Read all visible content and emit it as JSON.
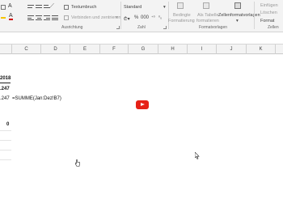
{
  "ribbon": {
    "wrap_text": "Textumbruch",
    "merge_center": "Verbinden und zentrieren",
    "number_format": "Standard",
    "conditional_formatting_l1": "Bedingte",
    "conditional_formatting_l2": "Formatierung",
    "format_as_table_l1": "Als Tabelle",
    "format_as_table_l2": "formatieren",
    "cell_styles": "Zellenformatvorlagen",
    "insert": "Einfügen",
    "delete": "Löschen",
    "format": "Format",
    "groups": {
      "alignment": "Ausrichtung",
      "number": "Zahl",
      "styles": "Formatvorlagen",
      "cells": "Zellen"
    }
  },
  "columns": [
    "C",
    "D",
    "E",
    "F",
    "G",
    "H",
    "I",
    "J",
    "K"
  ],
  "cells": {
    "year": "2018",
    "value1": ".247",
    "value2": ".247",
    "formula": "=SUMME(Jan:Dez!B7)",
    "zero": "0"
  },
  "colors": {
    "accent_yellow": "#f5c400",
    "font_red": "#d00000",
    "youtube_red": "#e62117"
  }
}
